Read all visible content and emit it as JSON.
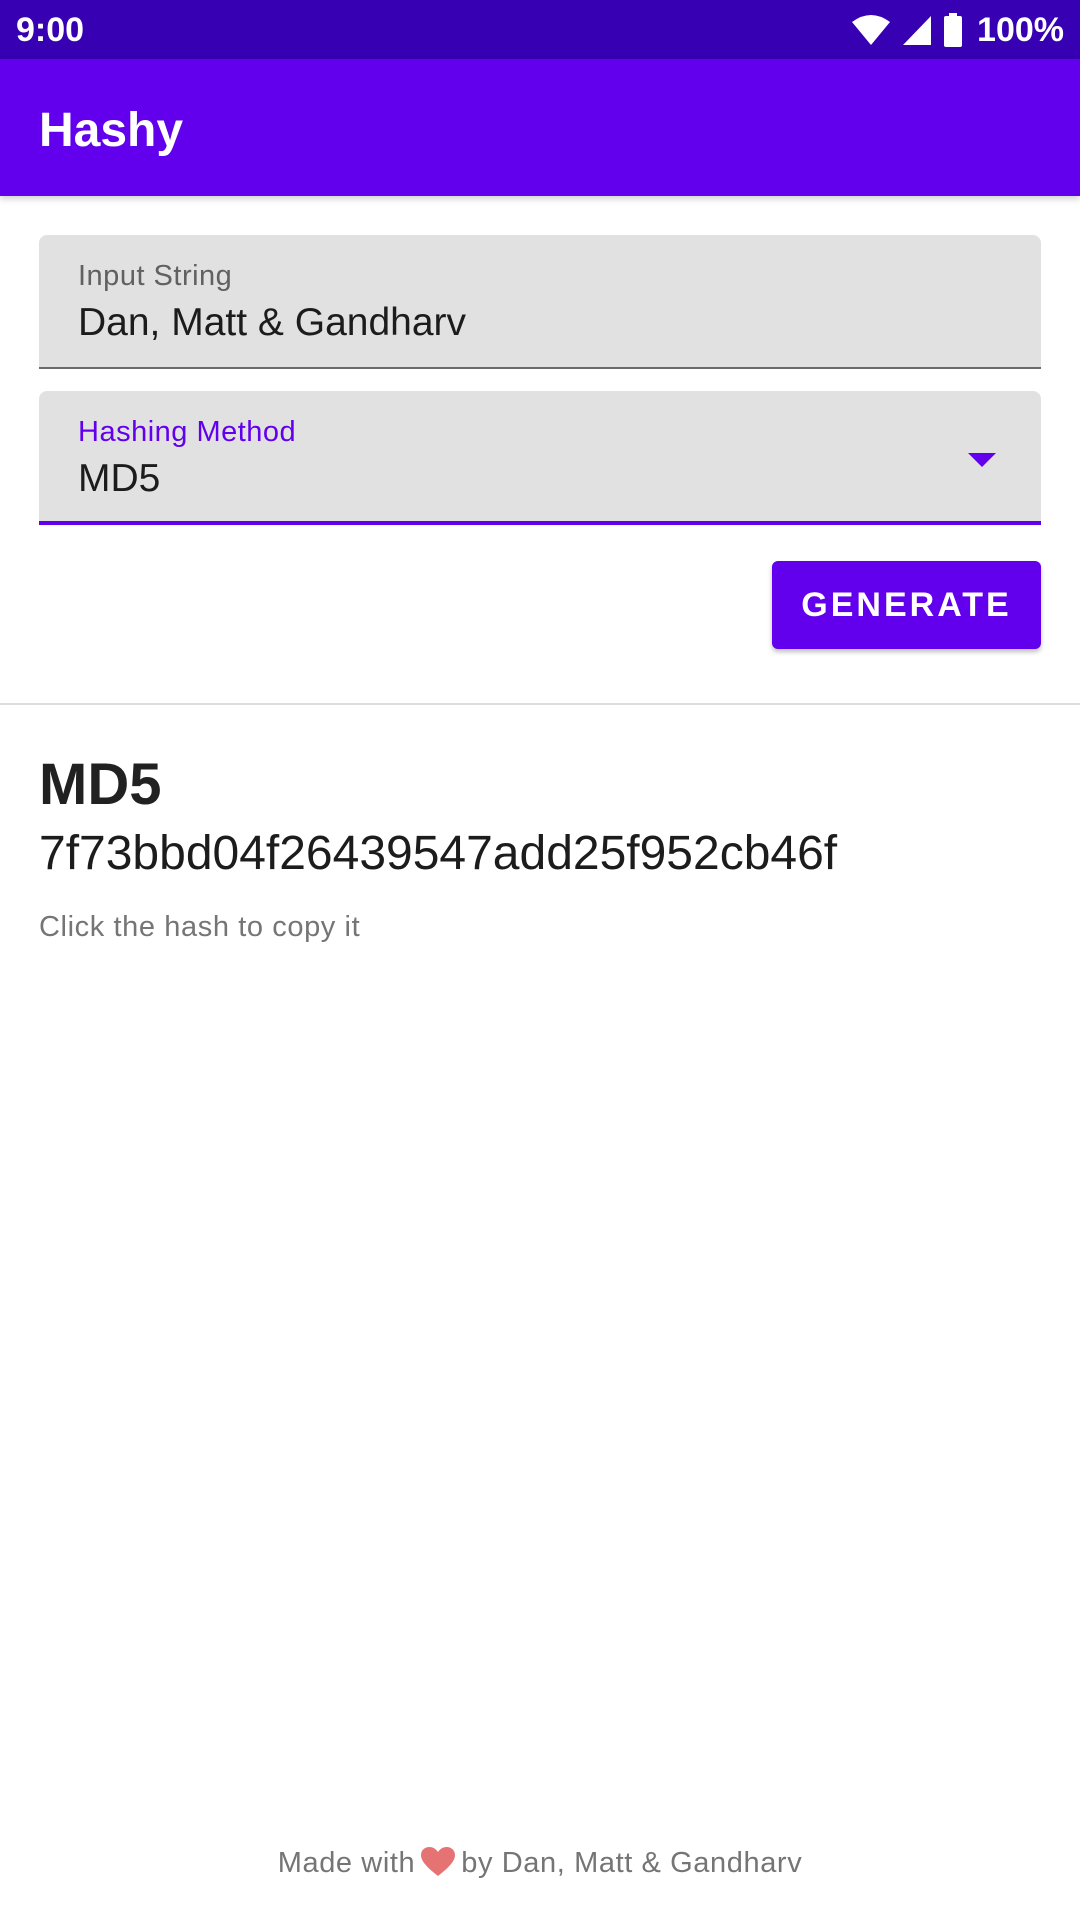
{
  "status_bar": {
    "time": "9:00",
    "battery": "100%",
    "icons": [
      "wifi-icon",
      "signal-icon",
      "battery-icon"
    ]
  },
  "app_bar": {
    "title": "Hashy"
  },
  "form": {
    "input": {
      "label": "Input String",
      "value": "Dan, Matt & Gandharv"
    },
    "method": {
      "label": "Hashing Method",
      "value": "MD5"
    },
    "generate_label": "GENERATE"
  },
  "result": {
    "method": "MD5",
    "hash": "7f73bbd04f26439547add25f952cb46f",
    "hint": "Click the hash to copy it"
  },
  "footer": {
    "prefix": "Made with",
    "icon": "heart-icon",
    "suffix": "by Dan, Matt & Gandharv"
  },
  "colors": {
    "status_bar": "#3700b3",
    "primary": "#6200ee",
    "field_bg": "#e1e1e1",
    "heart": "#e57373"
  }
}
